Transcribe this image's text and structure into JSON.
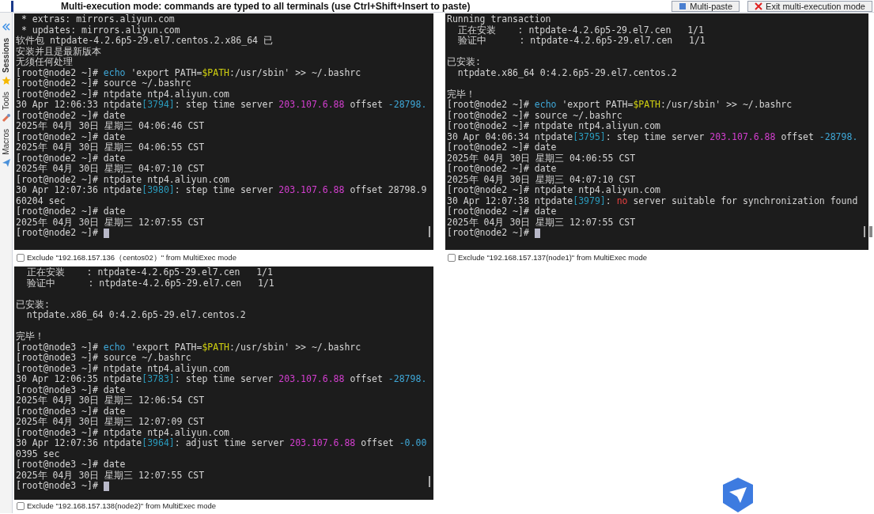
{
  "banner": {
    "text": "Multi-execution mode: commands are typed to all terminals (use Ctrl+Shift+Insert to paste)",
    "buttons": [
      "Multi-paste",
      "Exit multi-execution mode"
    ]
  },
  "sidebar": {
    "tabs": [
      "Sessions",
      "Tools",
      "Macros"
    ]
  },
  "terminals": [
    {
      "cursor": true,
      "exclude": {
        "label": "Exclude \"192.168.157.136（centos02）\" from MultiExec mode",
        "checked": false
      },
      "lines": [
        [
          {
            "kind": "plain",
            "text": " * extras: mirrors.aliyun.com"
          }
        ],
        [
          {
            "kind": "plain",
            "text": " * updates: mirrors.aliyun.com"
          }
        ],
        [
          {
            "kind": "plain",
            "text": "软件包 ntpdate-4.2.6p5-29.el7.centos.2.x86_64 已"
          }
        ],
        [
          {
            "kind": "plain",
            "text": "安装并且是最新版本"
          }
        ],
        [
          {
            "kind": "plain",
            "text": "无须任何处理"
          }
        ],
        [
          {
            "kind": "plain",
            "text": "[root@node2 ~]# "
          },
          {
            "kind": "command",
            "text": "echo"
          },
          {
            "kind": "plain",
            "text": " 'export PATH="
          },
          {
            "kind": "variable",
            "text": "$PATH"
          },
          {
            "kind": "plain",
            "text": ":/usr/sbin' >> ~/.bashrc"
          }
        ],
        [
          {
            "kind": "plain",
            "text": "[root@node2 ~]# source ~/.bashrc"
          }
        ],
        [
          {
            "kind": "plain",
            "text": "[root@node2 ~]# ntpdate ntp4.aliyun.com"
          }
        ],
        [
          {
            "kind": "plain",
            "text": "30 Apr 12:06:33 ntpdate"
          },
          {
            "kind": "pid",
            "text": "[3794]"
          },
          {
            "kind": "plain",
            "text": ": step time server "
          },
          {
            "kind": "address",
            "text": "203.107.6.88"
          },
          {
            "kind": "plain",
            "text": " offset "
          },
          {
            "kind": "number",
            "text": "-28798."
          }
        ],
        [
          {
            "kind": "plain",
            "text": "[root@node2 ~]# date"
          }
        ],
        [
          {
            "kind": "plain",
            "text": "2025年 04月 30日 星期三 04:06:46 CST"
          }
        ],
        [
          {
            "kind": "plain",
            "text": "[root@node2 ~]# date"
          }
        ],
        [
          {
            "kind": "plain",
            "text": "2025年 04月 30日 星期三 04:06:55 CST"
          }
        ],
        [
          {
            "kind": "plain",
            "text": "[root@node2 ~]# date"
          }
        ],
        [
          {
            "kind": "plain",
            "text": "2025年 04月 30日 星期三 04:07:10 CST"
          }
        ],
        [
          {
            "kind": "plain",
            "text": "[root@node2 ~]# ntpdate ntp4.aliyun.com"
          }
        ],
        [
          {
            "kind": "plain",
            "text": "30 Apr 12:07:36 ntpdate"
          },
          {
            "kind": "pid",
            "text": "[3980]"
          },
          {
            "kind": "plain",
            "text": ": step time server "
          },
          {
            "kind": "address",
            "text": "203.107.6.88"
          },
          {
            "kind": "plain",
            "text": " offset 28798.9"
          }
        ],
        [
          {
            "kind": "plain",
            "text": "60204 sec"
          }
        ],
        [
          {
            "kind": "plain",
            "text": "[root@node2 ~]# date"
          }
        ],
        [
          {
            "kind": "plain",
            "text": "2025年 04月 30日 星期三 12:07:55 CST"
          }
        ],
        [
          {
            "kind": "plain",
            "text": "[root@node2 ~]# "
          }
        ]
      ]
    },
    {
      "cursor": true,
      "exclude": {
        "label": "Exclude \"192.168.157.137(node1)\" from MultiExec mode",
        "checked": false
      },
      "lines": [
        [
          {
            "kind": "plain",
            "text": "Running transaction"
          }
        ],
        [
          {
            "kind": "plain",
            "text": "  正在安装    : ntpdate-4.2.6p5-29.el7.cen   1/1"
          }
        ],
        [
          {
            "kind": "plain",
            "text": "  验证中      : ntpdate-4.2.6p5-29.el7.cen   1/1"
          }
        ],
        [
          {
            "kind": "blank"
          }
        ],
        [
          {
            "kind": "plain",
            "text": "已安装:"
          }
        ],
        [
          {
            "kind": "plain",
            "text": "  ntpdate.x86_64 0:4.2.6p5-29.el7.centos.2"
          }
        ],
        [
          {
            "kind": "blank"
          }
        ],
        [
          {
            "kind": "plain",
            "text": "完毕！"
          }
        ],
        [
          {
            "kind": "plain",
            "text": "[root@node2 ~]# "
          },
          {
            "kind": "command",
            "text": "echo"
          },
          {
            "kind": "plain",
            "text": " 'export PATH="
          },
          {
            "kind": "variable",
            "text": "$PATH"
          },
          {
            "kind": "plain",
            "text": ":/usr/sbin' >> ~/.bashrc"
          }
        ],
        [
          {
            "kind": "plain",
            "text": "[root@node2 ~]# source ~/.bashrc"
          }
        ],
        [
          {
            "kind": "plain",
            "text": "[root@node2 ~]# ntpdate ntp4.aliyun.com"
          }
        ],
        [
          {
            "kind": "plain",
            "text": "30 Apr 04:06:34 ntpdate"
          },
          {
            "kind": "pid",
            "text": "[3795]"
          },
          {
            "kind": "plain",
            "text": ": step time server "
          },
          {
            "kind": "address",
            "text": "203.107.6.88"
          },
          {
            "kind": "plain",
            "text": " offset "
          },
          {
            "kind": "number",
            "text": "-28798."
          }
        ],
        [
          {
            "kind": "plain",
            "text": "[root@node2 ~]# date"
          }
        ],
        [
          {
            "kind": "plain",
            "text": "2025年 04月 30日 星期三 04:06:55 CST"
          }
        ],
        [
          {
            "kind": "plain",
            "text": "[root@node2 ~]# date"
          }
        ],
        [
          {
            "kind": "plain",
            "text": "2025年 04月 30日 星期三 04:07:10 CST"
          }
        ],
        [
          {
            "kind": "plain",
            "text": "[root@node2 ~]# ntpdate ntp4.aliyun.com"
          }
        ],
        [
          {
            "kind": "plain",
            "text": "30 Apr 12:07:38 ntpdate"
          },
          {
            "kind": "pid",
            "text": "[3979]"
          },
          {
            "kind": "plain",
            "text": ": "
          },
          {
            "kind": "error",
            "text": "no"
          },
          {
            "kind": "plain",
            "text": " server suitable for synchronization found"
          }
        ],
        [
          {
            "kind": "plain",
            "text": "[root@node2 ~]# date"
          }
        ],
        [
          {
            "kind": "plain",
            "text": "2025年 04月 30日 星期三 12:07:55 CST"
          }
        ],
        [
          {
            "kind": "plain",
            "text": "[root@node2 ~]# "
          }
        ]
      ]
    },
    {
      "cursor": true,
      "exclude": {
        "label": "Exclude \"192.168.157.138(node2)\" from MultiExec mode",
        "checked": false
      },
      "lines": [
        [
          {
            "kind": "plain",
            "text": "  正在安装    : ntpdate-4.2.6p5-29.el7.cen   1/1"
          }
        ],
        [
          {
            "kind": "plain",
            "text": "  验证中      : ntpdate-4.2.6p5-29.el7.cen   1/1"
          }
        ],
        [
          {
            "kind": "blank"
          }
        ],
        [
          {
            "kind": "plain",
            "text": "已安装:"
          }
        ],
        [
          {
            "kind": "plain",
            "text": "  ntpdate.x86_64 0:4.2.6p5-29.el7.centos.2"
          }
        ],
        [
          {
            "kind": "blank"
          }
        ],
        [
          {
            "kind": "plain",
            "text": "完毕！"
          }
        ],
        [
          {
            "kind": "plain",
            "text": "[root@node3 ~]# "
          },
          {
            "kind": "command",
            "text": "echo"
          },
          {
            "kind": "plain",
            "text": " 'export PATH="
          },
          {
            "kind": "variable",
            "text": "$PATH"
          },
          {
            "kind": "plain",
            "text": ":/usr/sbin' >> ~/.bashrc"
          }
        ],
        [
          {
            "kind": "plain",
            "text": "[root@node3 ~]# source ~/.bashrc"
          }
        ],
        [
          {
            "kind": "plain",
            "text": "[root@node3 ~]# ntpdate ntp4.aliyun.com"
          }
        ],
        [
          {
            "kind": "plain",
            "text": "30 Apr 12:06:35 ntpdate"
          },
          {
            "kind": "pid",
            "text": "[3783]"
          },
          {
            "kind": "plain",
            "text": ": step time server "
          },
          {
            "kind": "address",
            "text": "203.107.6.88"
          },
          {
            "kind": "plain",
            "text": " offset "
          },
          {
            "kind": "number",
            "text": "-28798."
          }
        ],
        [
          {
            "kind": "plain",
            "text": "[root@node3 ~]# date"
          }
        ],
        [
          {
            "kind": "plain",
            "text": "2025年 04月 30日 星期三 12:06:54 CST"
          }
        ],
        [
          {
            "kind": "plain",
            "text": "[root@node3 ~]# date"
          }
        ],
        [
          {
            "kind": "plain",
            "text": "2025年 04月 30日 星期三 12:07:09 CST"
          }
        ],
        [
          {
            "kind": "plain",
            "text": "[root@node3 ~]# ntpdate ntp4.aliyun.com"
          }
        ],
        [
          {
            "kind": "plain",
            "text": "30 Apr 12:07:36 ntpdate"
          },
          {
            "kind": "pid",
            "text": "[3964]"
          },
          {
            "kind": "plain",
            "text": ": adjust time server "
          },
          {
            "kind": "address",
            "text": "203.107.6.88"
          },
          {
            "kind": "plain",
            "text": " offset "
          },
          {
            "kind": "number",
            "text": "-0.00"
          }
        ],
        [
          {
            "kind": "plain",
            "text": "0395 sec"
          }
        ],
        [
          {
            "kind": "plain",
            "text": "[root@node3 ~]# date"
          }
        ],
        [
          {
            "kind": "plain",
            "text": "2025年 04月 30日 星期三 12:07:55 CST"
          }
        ],
        [
          {
            "kind": "plain",
            "text": "[root@node3 ~]# "
          }
        ]
      ]
    }
  ]
}
